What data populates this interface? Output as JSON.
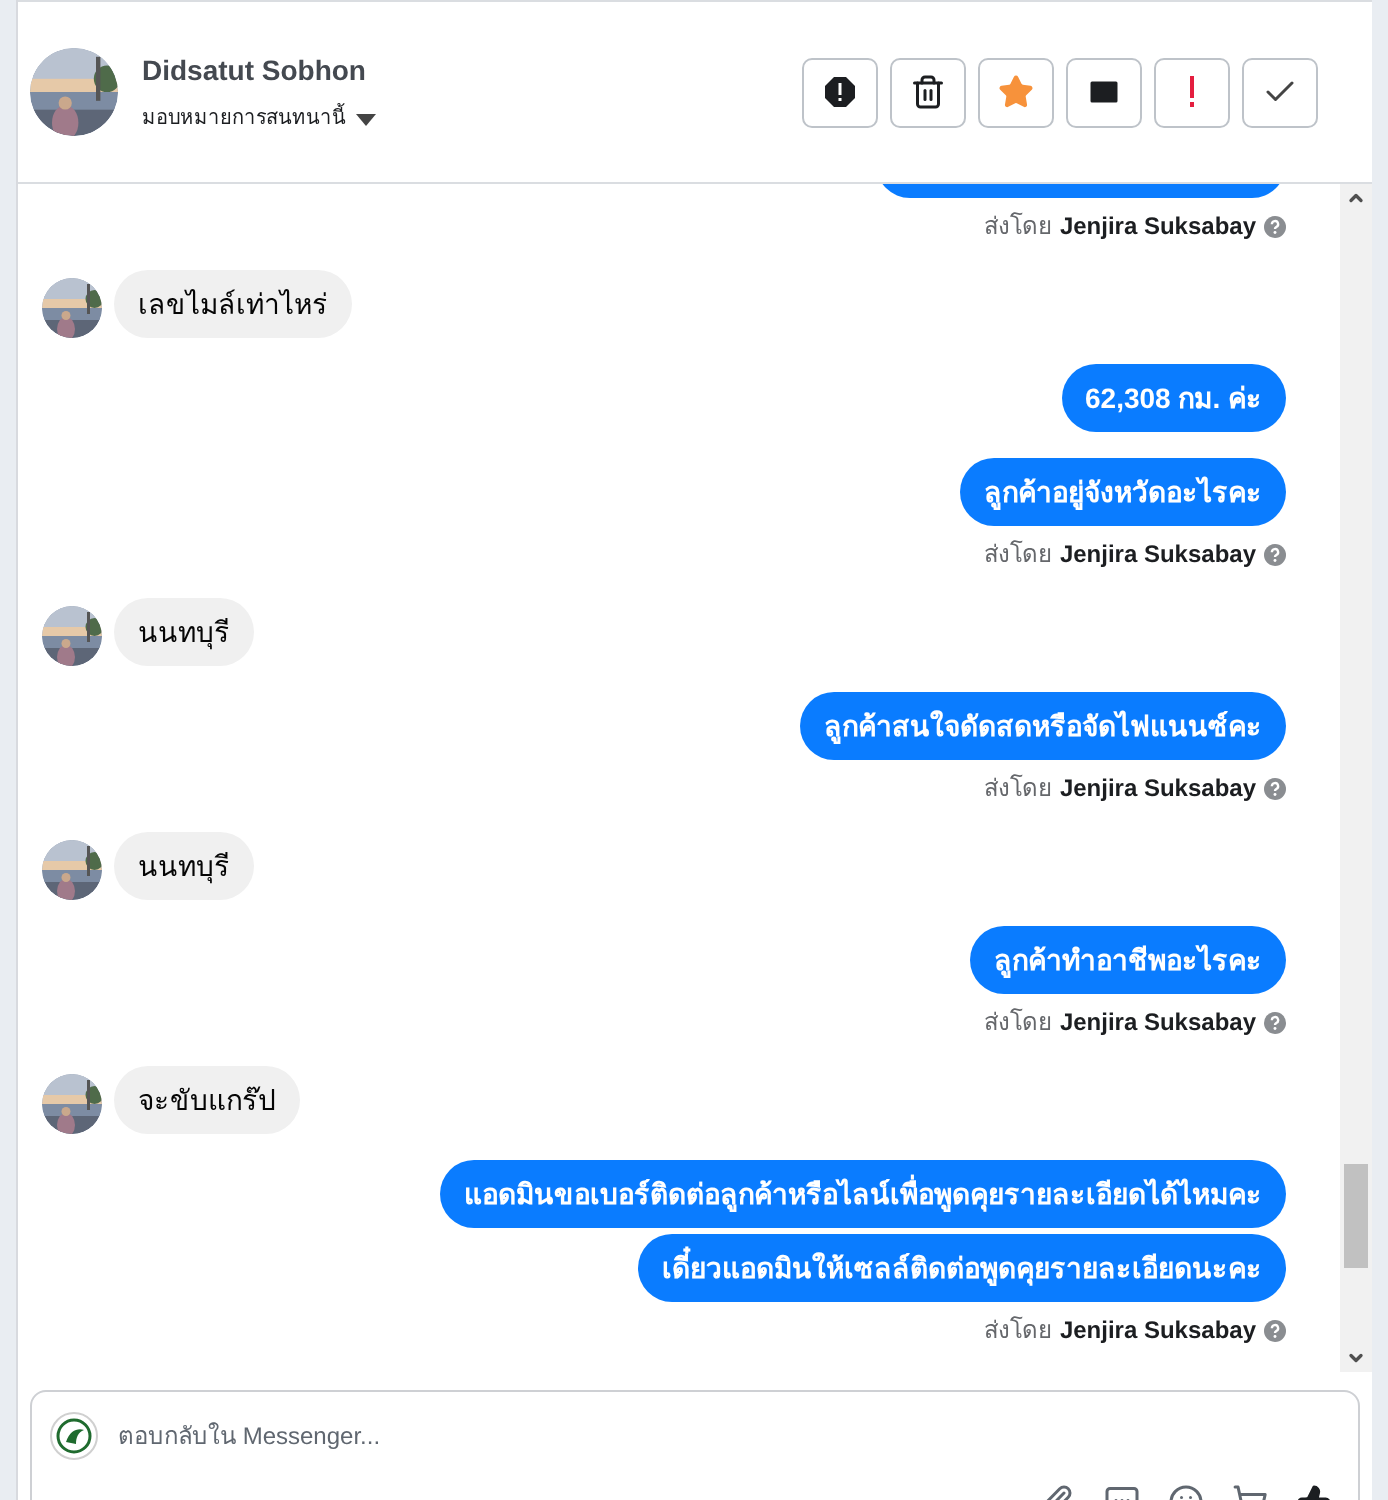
{
  "header": {
    "name": "Didsatut Sobhon",
    "assign_label": "มอบหมายการสนทนานี้"
  },
  "messages": [
    {
      "kind": "outgoing_cut_off",
      "sent_by_label": "ส่งโดย",
      "sender": "Jenjira Suksabay"
    },
    {
      "kind": "incoming",
      "bubbles": [
        "เลขไมล์เท่าไหร่"
      ]
    },
    {
      "kind": "outgoing",
      "bubbles": [
        "62,308 กม. ค่ะ"
      ]
    },
    {
      "kind": "outgoing",
      "bubbles": [
        "ลูกค้าอยู่จังหวัดอะไรคะ"
      ],
      "sent_by_label": "ส่งโดย",
      "sender": "Jenjira Suksabay"
    },
    {
      "kind": "incoming",
      "bubbles": [
        "นนทบุรี"
      ]
    },
    {
      "kind": "outgoing",
      "bubbles": [
        "ลูกค้าสนใจดัดสดหรือจัดไฟแนนซ์คะ"
      ],
      "sent_by_label": "ส่งโดย",
      "sender": "Jenjira Suksabay"
    },
    {
      "kind": "incoming",
      "bubbles": [
        "นนทบุรี"
      ]
    },
    {
      "kind": "outgoing",
      "bubbles": [
        "ลูกค้าทำอาชีพอะไรคะ"
      ],
      "sent_by_label": "ส่งโดย",
      "sender": "Jenjira Suksabay"
    },
    {
      "kind": "incoming",
      "bubbles": [
        "จะขับแกร๊ป"
      ]
    },
    {
      "kind": "outgoing",
      "bubbles": [
        "แอดมินขอเบอร์ติดต่อลูกค้าหรือไลน์เพื่อพูดคุยรายละเอียดได้ไหมคะ",
        "เดี๋ยวแอดมินให้เซลล์ติดต่อพูดคุยรายละเอียดนะคะ"
      ],
      "sent_by_label": "ส่งโดย",
      "sender": "Jenjira Suksabay"
    }
  ],
  "composer": {
    "placeholder": "ตอบกลับใน Messenger..."
  }
}
